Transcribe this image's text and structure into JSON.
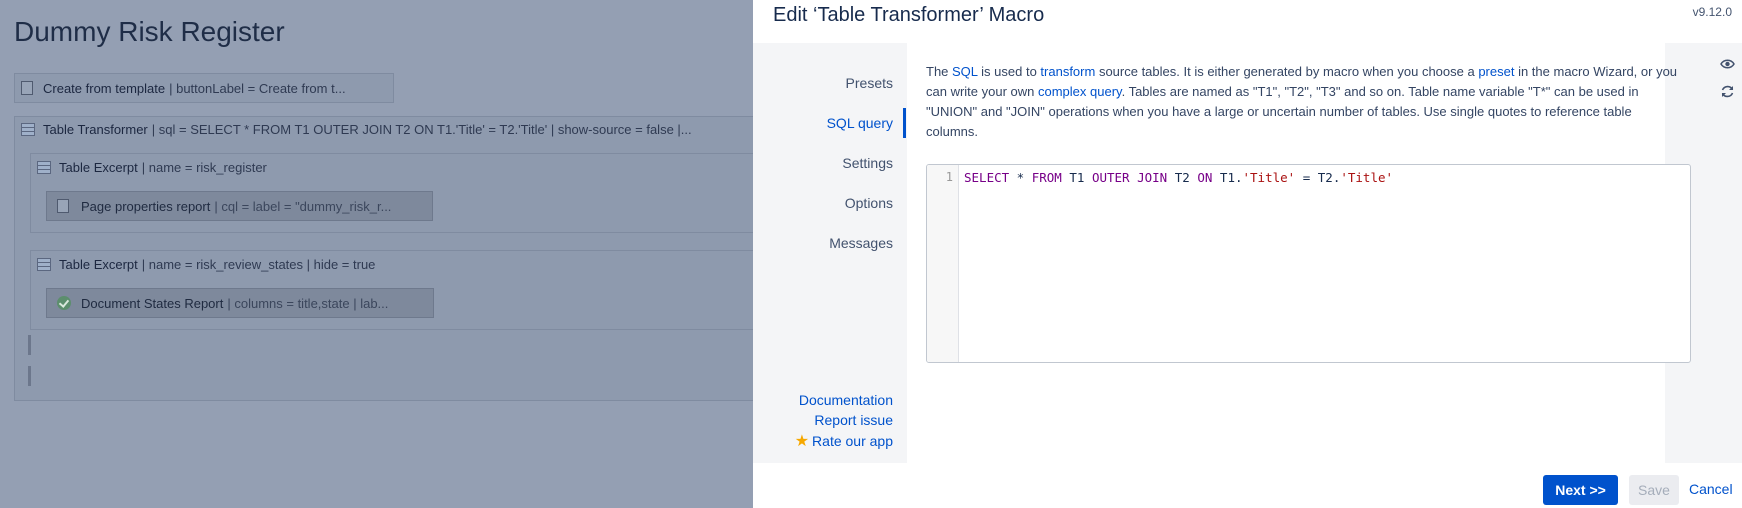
{
  "background": {
    "page_title": "Dummy Risk Register",
    "macros": {
      "create_from_template": {
        "name": "Create from template",
        "params": "| buttonLabel = Create from t..."
      },
      "table_transformer": {
        "name": "Table Transformer",
        "params": "| sql = SELECT * FROM T1 OUTER JOIN T2 ON T1.'Title' = T2.'Title' | show-source = false |..."
      },
      "excerpt_1": {
        "name": "Table Excerpt",
        "params": "| name = risk_register"
      },
      "page_properties": {
        "name": "Page properties report",
        "params": "| cql = label = \"dummy_risk_r..."
      },
      "excerpt_2": {
        "name": "Table Excerpt",
        "params": "| name = risk_review_states | hide = true"
      },
      "document_states": {
        "name": "Document States Report",
        "params": "| columns = title,state | lab..."
      }
    }
  },
  "dialog": {
    "title": "Edit ‘Table Transformer’ Macro",
    "version": "v9.12.0",
    "nav": {
      "items": [
        "Presets",
        "SQL query",
        "Settings",
        "Options",
        "Messages"
      ],
      "active": "SQL query"
    },
    "links": {
      "documentation": "Documentation",
      "report_issue": "Report issue",
      "rate": "Rate our app"
    },
    "description": {
      "p1": "The ",
      "sql": "SQL",
      "p2": " is used to ",
      "transform": "transform",
      "p3": " source tables. It is either generated by macro when you choose a ",
      "preset": "preset",
      "p4": " in the macro Wizard, or you can write your own ",
      "complex_query": "complex query",
      "p5": ". Tables are named as \"T1\", \"T2\", \"T3\" and so on. Table name variable \"T*\" can be used in \"UNION\" and \"JOIN\" operations when you have a large or uncertain number of tables. Use single quotes to reference table columns."
    },
    "editor": {
      "line_number": "1",
      "tokens": {
        "t1": "SELECT",
        "t2": " * ",
        "t3": "FROM",
        "t4": " T1 ",
        "t5": "OUTER JOIN",
        "t6": " T2 ",
        "t7": "ON",
        "t8": " T1.",
        "t9": "'Title'",
        "t10": " = T2.",
        "t11": "'Title'"
      }
    },
    "side_icons": [
      "eye-icon",
      "refresh-icon"
    ],
    "buttons": {
      "next": "Next >>",
      "save": "Save",
      "cancel": "Cancel"
    }
  },
  "colors": {
    "accent": "#0052cc",
    "overlay": "#949fb3",
    "sql_keyword": "#770088",
    "sql_string": "#aa1111"
  }
}
